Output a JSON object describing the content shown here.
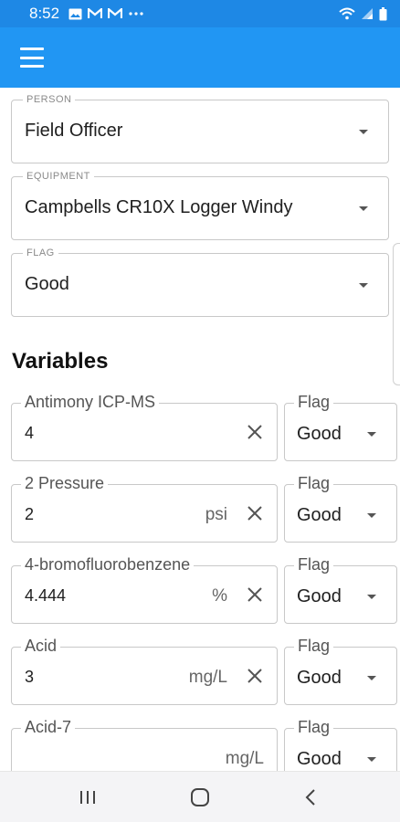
{
  "status_bar": {
    "time": "8:52",
    "left_icons": [
      "image-icon",
      "gmail-icon",
      "gmail-icon",
      "more-icon"
    ],
    "right_icons": [
      "wifi-icon",
      "signal-icon",
      "battery-icon"
    ]
  },
  "colors": {
    "status_bar": "#1e88e5",
    "app_bar": "#2196f3",
    "outline": "#c8c8c8",
    "nav_bar": "#f4f4f6"
  },
  "form": {
    "person": {
      "label": "PERSON",
      "value": "Field Officer"
    },
    "equipment": {
      "label": "EQUIPMENT",
      "value": "Campbells CR10X Logger Windy"
    },
    "flag": {
      "label": "FLAG",
      "value": "Good"
    }
  },
  "variables": {
    "title": "Variables",
    "items": [
      {
        "label": "Antimony ICP-MS",
        "value": "4",
        "unit": "",
        "flag_label": "Flag",
        "flag": "Good"
      },
      {
        "label": "2 Pressure",
        "value": "2",
        "unit": "psi",
        "flag_label": "Flag",
        "flag": "Good"
      },
      {
        "label": "4-bromofluorobenzene",
        "value": "4.444",
        "unit": "%",
        "flag_label": "Flag",
        "flag": "Good"
      },
      {
        "label": "Acid",
        "value": "3",
        "unit": "mg/L",
        "flag_label": "Flag",
        "flag": "Good"
      },
      {
        "label": "Acid-7",
        "value": "",
        "unit": "mg/L",
        "flag_label": "Flag",
        "flag": "Good"
      }
    ]
  },
  "nav": {
    "icons": [
      "recent-apps-icon",
      "home-icon",
      "back-icon"
    ]
  }
}
